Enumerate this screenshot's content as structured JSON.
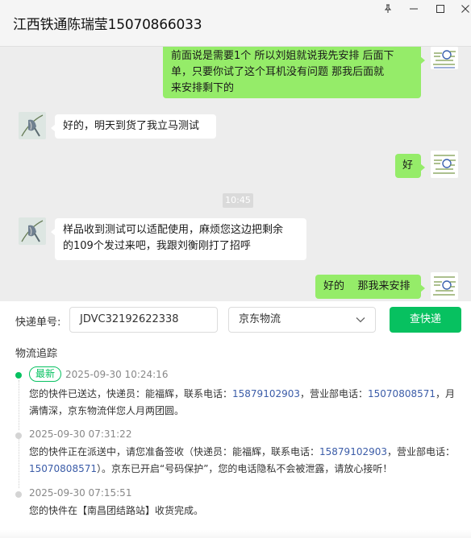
{
  "window": {
    "title": "江西铁通陈瑞莹15070866033",
    "buttons": [
      "pin-icon",
      "minimize-icon",
      "maximize-icon",
      "close-icon"
    ]
  },
  "messages": [
    {
      "from": "me",
      "lines": [
        "前面说是需要1个  所以刘姐就说我先安排 后面下",
        "单，只要你试了这个耳机没有问题  那我后面就",
        "来安排剩下的"
      ]
    },
    {
      "from": "them",
      "text": "好的，明天到货了我立马测试"
    },
    {
      "from": "me",
      "text": "好"
    },
    {
      "time": "10:45"
    },
    {
      "from": "them",
      "lines": [
        "样品收到测试可以适配使用，麻烦您这边把剩余",
        "的109个发过来吧，我跟刘衡刚打了招呼"
      ]
    },
    {
      "from": "me",
      "text": "好的    那我来安排"
    }
  ],
  "express": {
    "number_label": "快递单号:",
    "number_value": "JDVC32192622338",
    "carrier": "京东物流",
    "query_button": "查快递",
    "trace_title": "物流追踪",
    "events": [
      {
        "badge": "最新",
        "time": "2025-09-30 10:24:16",
        "text_a": "您的快件已送达，快递员：能福辉，联系电话：",
        "phone1": "15879102903",
        "text_b": "，营业部电话：",
        "phone2": "15070808571",
        "text_c": "，月满情深，京东物流伴您人月两团圆。"
      },
      {
        "time": "2025-09-30 07:31:22",
        "text_a": "您的快件正在派送中，请您准备签收（快递员：能福辉，联系电话：",
        "phone1": "15879102903",
        "text_b": "，营业部电话：",
        "phone2": "15070808571",
        "text_c": "）。京东已开启“号码保护”，您的电话隐私不会被泄露，请放心接听！"
      },
      {
        "time": "2025-09-30 07:15:51",
        "text": "您的快件在【南昌团结路站】收货完成。"
      }
    ]
  },
  "colors": {
    "accent": "#07c160",
    "my_bubble": "#95ec69",
    "their_bubble": "#ffffff",
    "chat_background": "#ededed",
    "phone_link": "#3b5ca8"
  }
}
